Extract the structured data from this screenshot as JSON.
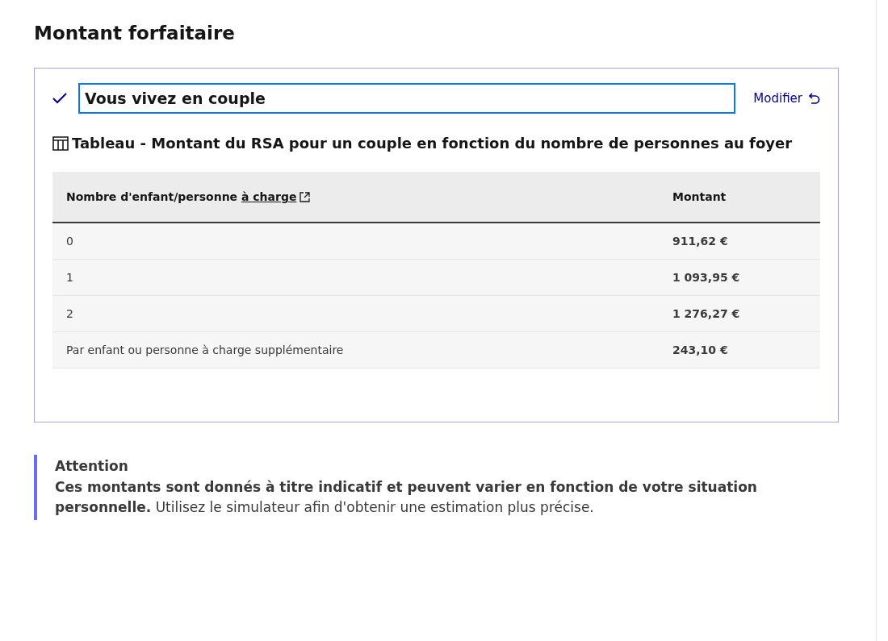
{
  "title": "Montant forfaitaire",
  "answer": {
    "text": "Vous vivez en couple",
    "edit_link": "Modifier"
  },
  "table": {
    "caption": "Tableau - Montant du RSA pour un couple en fonction du nombre de personnes au foyer",
    "columns": [
      {
        "text": "Nombre d'enfant/personne",
        "link": "à charge"
      },
      {
        "text": "Montant"
      }
    ],
    "rows": [
      [
        "0",
        "911,62 €"
      ],
      [
        "1",
        "1 093,95 €"
      ],
      [
        "2",
        "1 276,27 €"
      ],
      [
        "Par enfant ou personne à charge supplémentaire",
        "243,10 €"
      ]
    ]
  },
  "notice": {
    "title": "Attention",
    "body": "**Ces montants sont donnés à titre indicatif et peuvent varier en fonction de votre situation personnelle.** Utilisez le simulateur afin d'obtenir une estimation plus précise."
  }
}
